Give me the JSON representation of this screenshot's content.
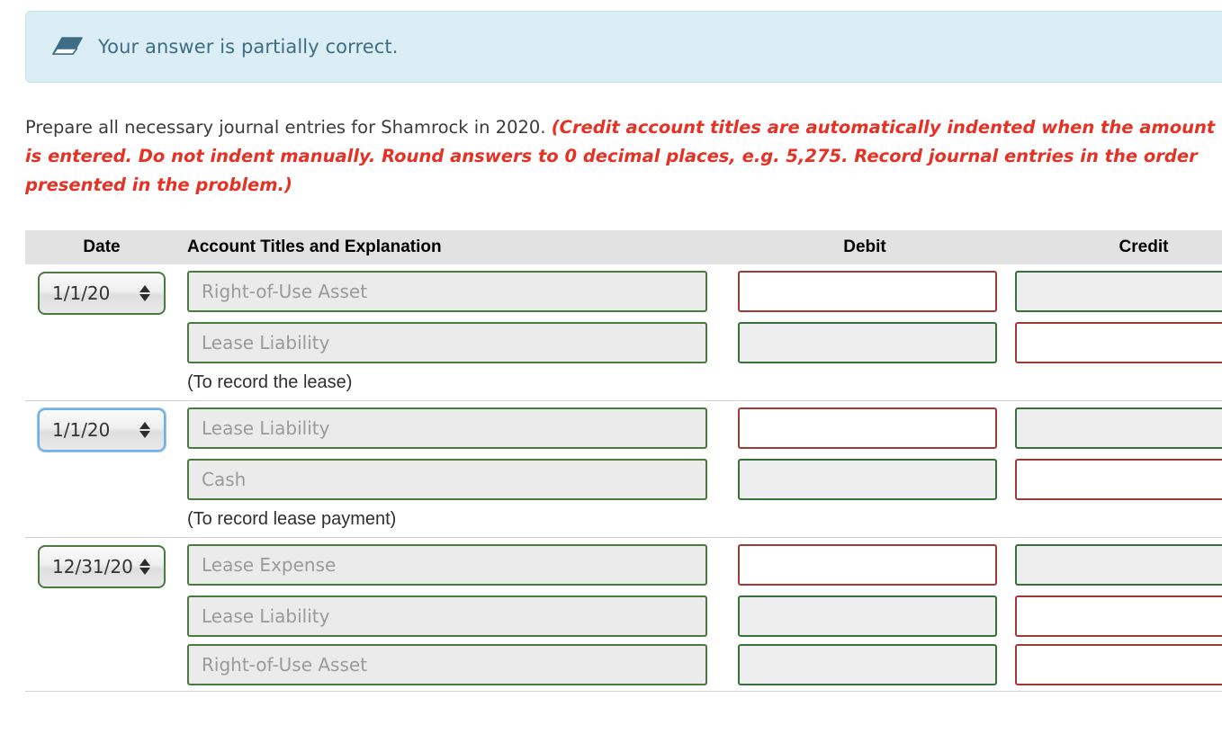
{
  "banner": {
    "icon": "eraser-icon",
    "message": "Your answer is partially correct.",
    "background_color": "#dceef5",
    "text_color": "#3d6d85"
  },
  "instructions": {
    "lead": "Prepare all necessary journal entries for Shamrock in 2020. ",
    "hint": "(Credit account titles are automatically indented when the amount is entered. Do not indent manually. Round answers to 0 decimal places, e.g. 5,275. Record journal entries in the order presented in the problem.)",
    "hint_color": "#e63125"
  },
  "table": {
    "headers": {
      "date": "Date",
      "account": "Account Titles and Explanation",
      "debit": "Debit",
      "credit": "Credit"
    },
    "header_background": "#e2e2e2",
    "entries": [
      {
        "date_value": "1/1/20",
        "date_focused": false,
        "lines": [
          {
            "account_placeholder": "Right-of-Use Asset",
            "account_value": "",
            "debit_value": "",
            "debit_state": "incorrect",
            "credit_value": "",
            "credit_state": "correct"
          },
          {
            "account_placeholder": "Lease Liability",
            "account_value": "",
            "debit_value": "",
            "debit_state": "correct",
            "credit_value": "",
            "credit_state": "incorrect"
          }
        ],
        "explanation": "(To record the lease)"
      },
      {
        "date_value": "1/1/20",
        "date_focused": true,
        "lines": [
          {
            "account_placeholder": "Lease Liability",
            "account_value": "",
            "debit_value": "",
            "debit_state": "incorrect",
            "credit_value": "",
            "credit_state": "correct"
          },
          {
            "account_placeholder": "Cash",
            "account_value": "",
            "debit_value": "",
            "debit_state": "correct",
            "credit_value": "",
            "credit_state": "incorrect"
          }
        ],
        "explanation": "(To record lease payment)"
      },
      {
        "date_value": "12/31/20",
        "date_focused": false,
        "lines": [
          {
            "account_placeholder": "Lease Expense",
            "account_value": "",
            "debit_value": "",
            "debit_state": "incorrect",
            "credit_value": "",
            "credit_state": "correct"
          },
          {
            "account_placeholder": "Lease Liability",
            "account_value": "",
            "debit_value": "",
            "debit_state": "correct",
            "credit_value": "",
            "credit_state": "incorrect"
          },
          {
            "account_placeholder": "Right-of-Use Asset",
            "account_value": "",
            "debit_value": "",
            "debit_state": "correct",
            "credit_value": "",
            "credit_state": "incorrect"
          }
        ],
        "explanation": ""
      }
    ],
    "colors": {
      "correct_border": "#37703b",
      "incorrect_border": "#9e3b36",
      "select_border": "#4b7a3f",
      "select_focus_border": "#73aee0",
      "disabled_fill": "#ebebeb"
    }
  }
}
